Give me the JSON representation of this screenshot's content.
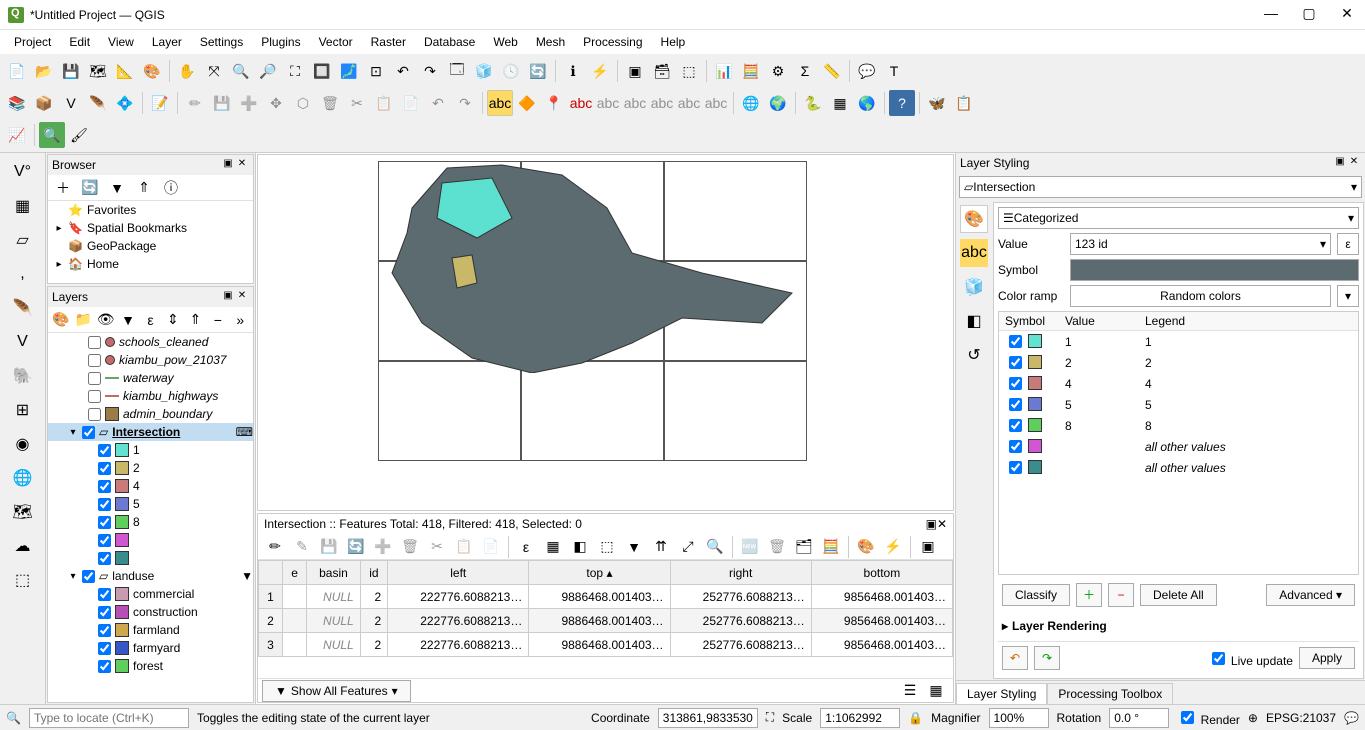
{
  "window": {
    "title": "*Untitled Project — QGIS"
  },
  "menu": [
    "Project",
    "Edit",
    "View",
    "Layer",
    "Settings",
    "Plugins",
    "Vector",
    "Raster",
    "Database",
    "Web",
    "Mesh",
    "Processing",
    "Help"
  ],
  "browser": {
    "title": "Browser",
    "items": [
      "Favorites",
      "Spatial Bookmarks",
      "GeoPackage",
      "Home"
    ]
  },
  "layers": {
    "title": "Layers",
    "items": [
      {
        "label": "schools_cleaned",
        "type": "point",
        "color": "#c36a6a"
      },
      {
        "label": "kiambu_pow_21037",
        "type": "point",
        "color": "#c36a6a"
      },
      {
        "label": "waterway",
        "type": "line",
        "color": "#68a36a"
      },
      {
        "label": "kiambu_highways",
        "type": "line",
        "color": "#c36a6a"
      },
      {
        "label": "admin_boundary",
        "type": "fill",
        "color": "#9c7a4a"
      }
    ],
    "intersection": {
      "label": "Intersection",
      "classes": [
        {
          "label": "1",
          "color": "#62e2d1"
        },
        {
          "label": "2",
          "color": "#c9b76a"
        },
        {
          "label": "4",
          "color": "#c97a7a"
        },
        {
          "label": "5",
          "color": "#6a7ad1"
        },
        {
          "label": "8",
          "color": "#5fce5f"
        },
        {
          "label": "",
          "color": "#d156d1"
        },
        {
          "label": "",
          "color": "#3a8d8d"
        }
      ]
    },
    "landuse": {
      "label": "landuse",
      "classes": [
        {
          "label": "commercial",
          "color": "#c99bb0"
        },
        {
          "label": "construction",
          "color": "#b64fb6"
        },
        {
          "label": "farmland",
          "color": "#cda84f"
        },
        {
          "label": "farmyard",
          "color": "#3956c9"
        },
        {
          "label": "forest",
          "color": "#5fce5f"
        }
      ]
    }
  },
  "map": {},
  "attr": {
    "title": "Intersection :: Features Total: 418, Filtered: 418, Selected: 0",
    "columns": [
      "e",
      "basin",
      "id",
      "left",
      "top",
      "right",
      "bottom"
    ],
    "rows": [
      {
        "n": "1",
        "e": "",
        "basin": "NULL",
        "id": "2",
        "left": "222776.6088213…",
        "top": "9886468.001403…",
        "right": "252776.6088213…",
        "bottom": "9856468.001403…"
      },
      {
        "n": "2",
        "e": "",
        "basin": "NULL",
        "id": "2",
        "left": "222776.6088213…",
        "top": "9886468.001403…",
        "right": "252776.6088213…",
        "bottom": "9856468.001403…",
        "sel": true
      },
      {
        "n": "3",
        "e": "",
        "basin": "NULL",
        "id": "2",
        "left": "222776.6088213…",
        "top": "9886468.001403…",
        "right": "252776.6088213…",
        "bottom": "9856468.001403…"
      }
    ],
    "footer_btn": "Show All Features"
  },
  "styling": {
    "title": "Layer Styling",
    "layer": "Intersection",
    "renderer": "Categorized",
    "value_label": "Value",
    "value": "123 id",
    "symbol_label": "Symbol",
    "ramp_label": "Color ramp",
    "ramp": "Random colors",
    "columns": [
      "Symbol",
      "Value",
      "Legend"
    ],
    "classes": [
      {
        "color": "#62e2d1",
        "value": "1",
        "legend": "1"
      },
      {
        "color": "#c9b76a",
        "value": "2",
        "legend": "2"
      },
      {
        "color": "#c97a7a",
        "value": "4",
        "legend": "4"
      },
      {
        "color": "#6a7ad1",
        "value": "5",
        "legend": "5"
      },
      {
        "color": "#5fce5f",
        "value": "8",
        "legend": "8"
      },
      {
        "color": "#d156d1",
        "value": "",
        "legend": "all other values",
        "italic": true
      },
      {
        "color": "#3a8d8d",
        "value": "",
        "legend": "all other values",
        "italic": true
      }
    ],
    "btn_classify": "Classify",
    "btn_delete": "Delete All",
    "btn_advanced": "Advanced",
    "layer_rendering": "Layer Rendering",
    "live_update": "Live update",
    "btn_apply": "Apply",
    "tabs": [
      "Layer Styling",
      "Processing Toolbox"
    ]
  },
  "status": {
    "locator_placeholder": "Type to locate (Ctrl+K)",
    "message": "Toggles the editing state of the current layer",
    "coord_label": "Coordinate",
    "coord": "313861,9833530",
    "scale_label": "Scale",
    "scale": "1:1062992",
    "mag_label": "Magnifier",
    "mag": "100%",
    "rot_label": "Rotation",
    "rot": "0.0 °",
    "render": "Render",
    "crs": "EPSG:21037"
  }
}
